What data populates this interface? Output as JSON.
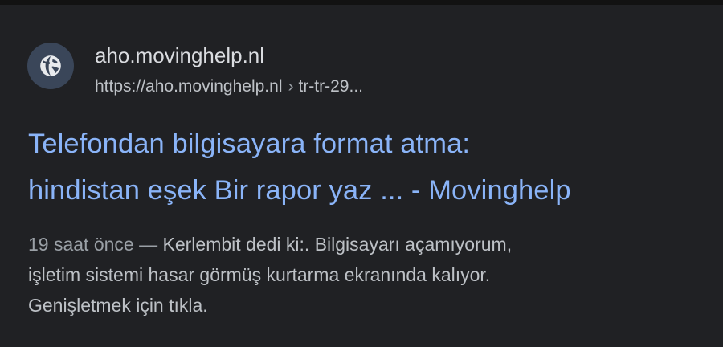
{
  "result": {
    "site_name": "aho.movinghelp.nl",
    "url": "https://aho.movinghelp.nl",
    "path_separator": "›",
    "path": "tr-tr-29...",
    "title_line1": "Telefondan bilgisayara format atma:",
    "title_line2": "hindistan eşek Bir rapor yaz ... - Movinghelp",
    "age": "19 saat önce",
    "dash": "—",
    "snippet_line1": "Kerlembit dedi ki:. Bilgisayarı açamıyorum,",
    "snippet_line2": "işletim sistemi hasar görmüş kurtarma ekranında kalıyor.",
    "snippet_line3": "Genişletmek için tıkla.",
    "favicon_icon": "globe-icon"
  },
  "colors": {
    "background": "#202124",
    "top_border": "#121212",
    "favicon_bg": "#3a4659",
    "favicon_fg": "#e8eaed",
    "link": "#8ab4f8",
    "text": "#bdc1c6",
    "site_name": "#dadce0"
  }
}
